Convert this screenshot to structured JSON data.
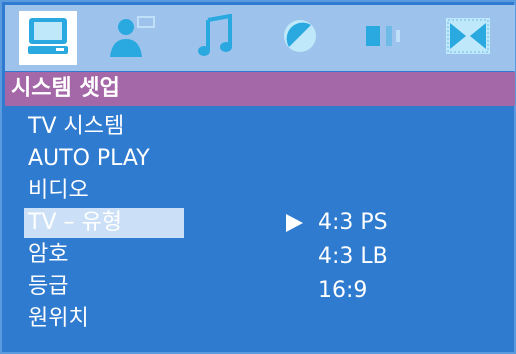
{
  "title": "시스템 셋업",
  "tabs": [
    {
      "icon": "monitor-icon",
      "selected": true
    },
    {
      "icon": "speaker-person-icon",
      "selected": false
    },
    {
      "icon": "music-note-icon",
      "selected": false
    },
    {
      "icon": "half-circle-icon",
      "selected": false
    },
    {
      "icon": "speaker-icon",
      "selected": false
    },
    {
      "icon": "dolby-icon",
      "selected": false
    }
  ],
  "menu": [
    {
      "label": "TV 시스템"
    },
    {
      "label": "AUTO PLAY"
    },
    {
      "label": "비디오"
    },
    {
      "label": "TV – 유형",
      "selected": true
    },
    {
      "label": "암호"
    },
    {
      "label": "등급"
    },
    {
      "label": "원위치"
    }
  ],
  "options": [
    {
      "label": "4:3 PS",
      "current": true
    },
    {
      "label": "4:3 LB"
    },
    {
      "label": "16:9"
    }
  ],
  "colors": {
    "background": "#2f7bd0",
    "tab_bar": "#9dc3ec",
    "title_bar": "#a467a7",
    "selection": "#cbe0f6"
  }
}
